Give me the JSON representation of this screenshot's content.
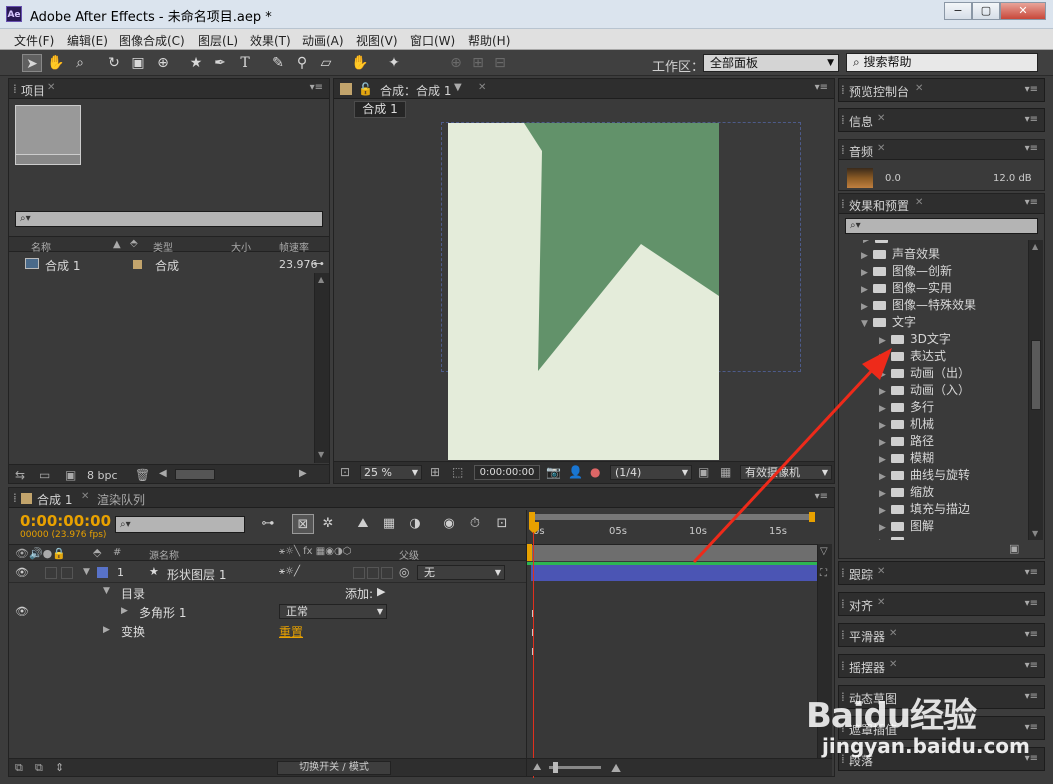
{
  "window": {
    "logo": "Ae",
    "title": "Adobe After Effects - 未命名项目.aep *",
    "minimize": "−",
    "maximize": "▢",
    "close": "✕"
  },
  "menu": [
    "文件(F)",
    "编辑(E)",
    "图像合成(C)",
    "图层(L)",
    "效果(T)",
    "动画(A)",
    "视图(V)",
    "窗口(W)",
    "帮助(H)"
  ],
  "toolbar": {
    "workspace_label": "工作区：",
    "workspace_value": "全部面板",
    "help_search_placeholder": "搜索帮助"
  },
  "project_panel": {
    "tab": "项目",
    "columns": {
      "name": "名称",
      "type": "类型",
      "size": "大小",
      "fps": "帧速率"
    },
    "items": [
      {
        "name": "合成 1",
        "type": "合成",
        "size": "",
        "fps": "23.976"
      }
    ],
    "footer_bpc": "8 bpc"
  },
  "comp_panel": {
    "tab": "合成：合成 1",
    "subtab": "合成 1",
    "zoom": "25 %",
    "timecode": "0:00:00:00",
    "resolution": "(1/4)",
    "camera": "有效摄像机"
  },
  "right_panels": {
    "preview": "预览控制台",
    "info": "信息",
    "audio": "音频",
    "audio_left": "0.0",
    "audio_right": "12.0 dB",
    "effects": "效果和预置",
    "tracker": "跟踪",
    "align": "对齐",
    "smoother": "平滑器",
    "wiggler": "摇摆器",
    "motion_sketch": "动态草图",
    "mask_interp": "遮罩插值",
    "paragraph": "段落"
  },
  "effects_tree": [
    {
      "label": "声音效果",
      "level": 1,
      "open": false
    },
    {
      "label": "图像—创新",
      "level": 1,
      "open": false
    },
    {
      "label": "图像—实用",
      "level": 1,
      "open": false
    },
    {
      "label": "图像—特殊效果",
      "level": 1,
      "open": false
    },
    {
      "label": "文字",
      "level": 1,
      "open": true
    },
    {
      "label": "3D文字",
      "level": 2,
      "open": false
    },
    {
      "label": "表达式",
      "level": 2,
      "open": false
    },
    {
      "label": "动画（出）",
      "level": 2,
      "open": false
    },
    {
      "label": "动画（入）",
      "level": 2,
      "open": false
    },
    {
      "label": "多行",
      "level": 2,
      "open": false
    },
    {
      "label": "机械",
      "level": 2,
      "open": false
    },
    {
      "label": "路径",
      "level": 2,
      "open": false
    },
    {
      "label": "模糊",
      "level": 2,
      "open": false
    },
    {
      "label": "曲线与旋转",
      "level": 2,
      "open": false
    },
    {
      "label": "缩放",
      "level": 2,
      "open": false
    },
    {
      "label": "填充与描边",
      "level": 2,
      "open": false
    },
    {
      "label": "图解",
      "level": 2,
      "open": false
    }
  ],
  "timeline": {
    "tab": "合成 1",
    "render_tab": "渲染队列",
    "timecode": "0:00:00:00",
    "fps_line": "00000 (23.976 fps)",
    "col_num": "#",
    "col_source": "源名称",
    "col_parent": "父级",
    "ruler": [
      "0s",
      "05s",
      "10s",
      "15s"
    ],
    "layer": {
      "num": "1",
      "name": "形状图层 1",
      "parent": "无"
    },
    "contents": "目录",
    "add_label": "添加:",
    "polygon": "多角形 1",
    "blend": "正常",
    "transform": "变换",
    "reset": "重置",
    "footer_toggle": "切换开关 / 模式"
  },
  "watermark": {
    "brand": "Baidu经验",
    "url": "jingyan.baidu.com"
  },
  "colors": {
    "timecode_orange": "#e8a100",
    "layer_bar": "#4b55b4",
    "shape_dark_green": "#62926a",
    "shape_light": "#e4ecda",
    "annotation_red": "#ee2a1a"
  }
}
